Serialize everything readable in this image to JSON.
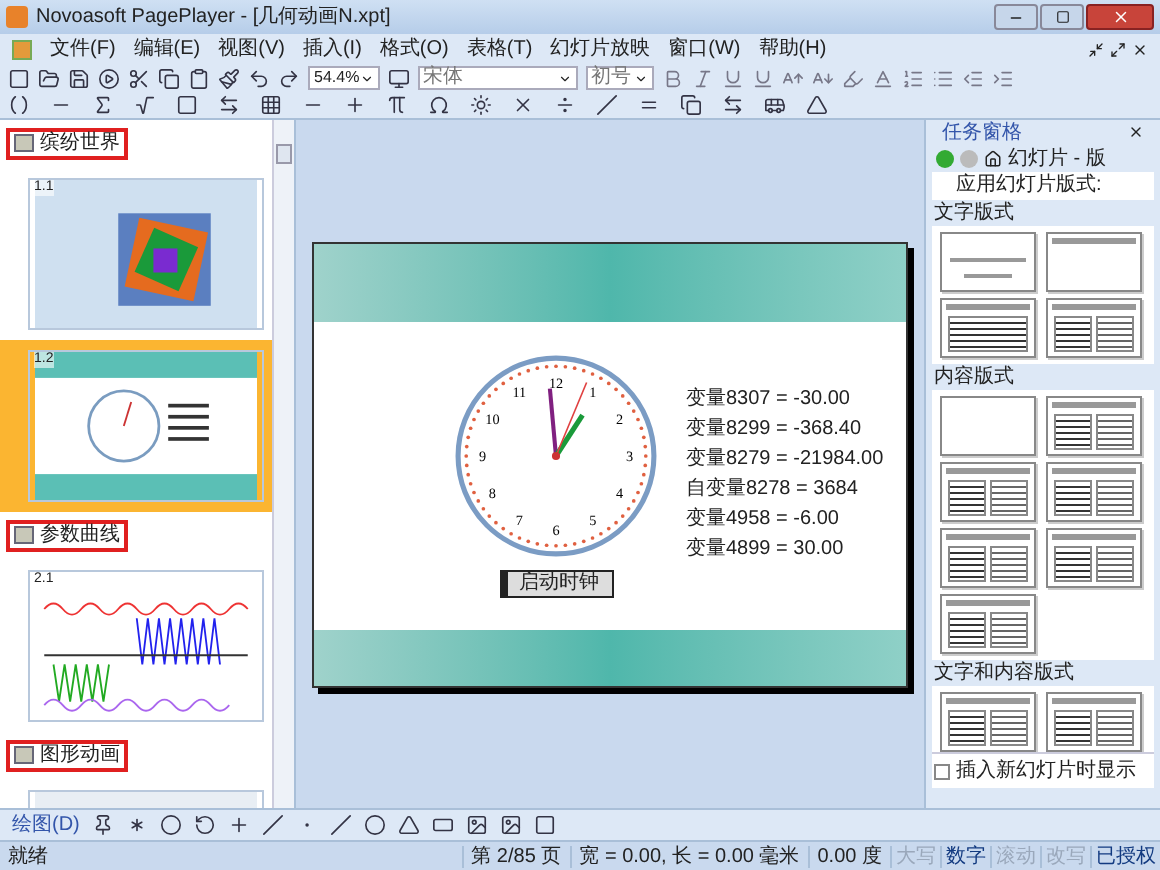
{
  "window": {
    "title": "Novoasoft PagePlayer - [几何动画N.xpt]"
  },
  "menu": [
    "文件(F)",
    "编辑(E)",
    "视图(V)",
    "插入(I)",
    "格式(O)",
    "表格(T)",
    "幻灯片放映",
    "窗口(W)",
    "帮助(H)"
  ],
  "toolbar": {
    "zoom": "54.4%",
    "font": "宋体",
    "size": "初号"
  },
  "sections": [
    {
      "title": "缤纷世界",
      "slides": [
        {
          "number": "1.1",
          "kind": "pattern",
          "selected": false
        },
        {
          "number": "1.2",
          "kind": "clock",
          "selected": true
        }
      ]
    },
    {
      "title": "参数曲线",
      "slides": [
        {
          "number": "2.1",
          "kind": "waves",
          "selected": false
        }
      ]
    },
    {
      "title": "图形动画",
      "slides": [
        {
          "kind": "animation",
          "selected": false
        }
      ]
    }
  ],
  "slide": {
    "numerals": [
      "12",
      "1",
      "2",
      "3",
      "4",
      "5",
      "6",
      "7",
      "8",
      "9",
      "10",
      "11"
    ],
    "variables": [
      "变量8307 = -30.00",
      "变量8299 = -368.40",
      "变量8279 = -21984.00",
      "自变量8278 = 3684",
      "变量4958 = -6.00",
      "变量4899 = 30.00"
    ],
    "button": "启动时钟"
  },
  "task_pane": {
    "title": "任务窗格",
    "nav": "幻灯片 - 版",
    "subtitle": "应用幻灯片版式:",
    "groups": [
      {
        "title": "文字版式",
        "layouts": [
          {
            "kind": "title"
          },
          {
            "kind": "title-only"
          },
          {
            "kind": "bullets"
          },
          {
            "kind": "two-column"
          }
        ]
      },
      {
        "title": "内容版式",
        "layouts": [
          {
            "kind": "blank"
          },
          {
            "kind": "content"
          },
          {
            "kind": "title-content"
          },
          {
            "kind": "two-content"
          },
          {
            "kind": "content-mix"
          },
          {
            "kind": "content-mix"
          },
          {
            "kind": "four-content"
          }
        ]
      },
      {
        "title": "文字和内容版式",
        "layouts": [
          {
            "kind": "text-content"
          },
          {
            "kind": "content-text"
          }
        ]
      }
    ],
    "show_on_insert": {
      "label": "插入新幻灯片时显示",
      "checked": false
    }
  },
  "drawing_toolbar": {
    "label": "绘图(D)"
  },
  "status_bar": {
    "status": "就绪",
    "page": "第 2/85 页",
    "size": "宽 = 0.00, 长 = 0.00 毫米",
    "angle": "0.00 度",
    "indicators": [
      {
        "text": "大写",
        "disabled": true
      },
      {
        "text": "数字",
        "disabled": false
      },
      {
        "text": "滚动",
        "disabled": true
      },
      {
        "text": "改写",
        "disabled": true
      },
      {
        "text": "已授权",
        "disabled": false
      }
    ]
  }
}
